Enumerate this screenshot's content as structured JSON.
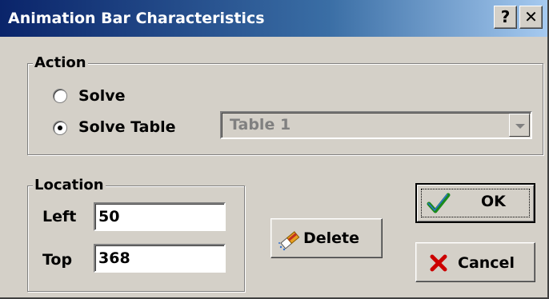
{
  "window": {
    "title": "Animation Bar Characteristics",
    "help_glyph": "?",
    "close_glyph": "✕"
  },
  "action_group": {
    "legend": "Action",
    "options": [
      {
        "label": "Solve",
        "checked": false
      },
      {
        "label": "Solve Table",
        "checked": true
      }
    ],
    "table_select": {
      "value": "Table 1",
      "enabled": false
    }
  },
  "location_group": {
    "legend": "Location",
    "left_label": "Left",
    "left_value": "50",
    "top_label": "Top",
    "top_value": "368"
  },
  "buttons": {
    "ok": {
      "label": "OK",
      "icon": "checkmark-icon",
      "color": "#1a8a1a"
    },
    "delete": {
      "label": "Delete",
      "icon": "eraser-icon"
    },
    "cancel": {
      "label": "Cancel",
      "icon": "x-mark-icon",
      "color": "#cc0000"
    }
  }
}
